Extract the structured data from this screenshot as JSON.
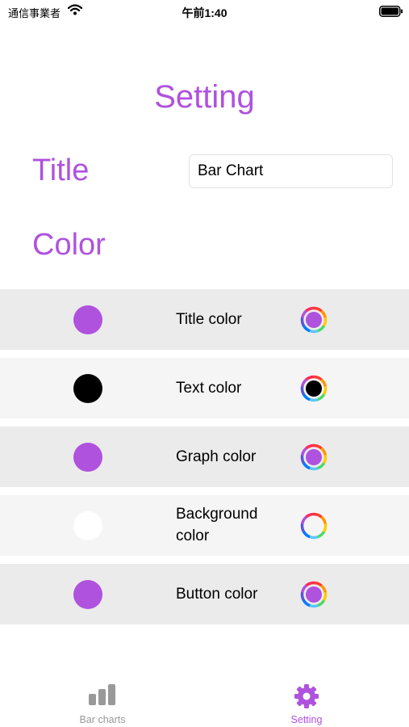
{
  "status_bar": {
    "carrier": "通信事業者",
    "time": "午前1:40"
  },
  "accent_color": "#af52de",
  "page_title": "Setting",
  "title_section": {
    "label": "Title",
    "input_value": "Bar Chart"
  },
  "color_section": {
    "heading": "Color",
    "rows": [
      {
        "label": "Title color",
        "swatch_color": "#af52de"
      },
      {
        "label": "Text color",
        "swatch_color": "#000000"
      },
      {
        "label": "Graph color",
        "swatch_color": "#af52de"
      },
      {
        "label": "Background color",
        "swatch_color": "#ffffff"
      },
      {
        "label": "Button color",
        "swatch_color": "#af52de"
      }
    ]
  },
  "tab_bar": {
    "tabs": [
      {
        "label": "Bar charts",
        "icon": "bar-chart-icon",
        "selected": false,
        "color": "#999999"
      },
      {
        "label": "Setting",
        "icon": "gear-icon",
        "selected": true,
        "color": "#af52de"
      }
    ]
  }
}
